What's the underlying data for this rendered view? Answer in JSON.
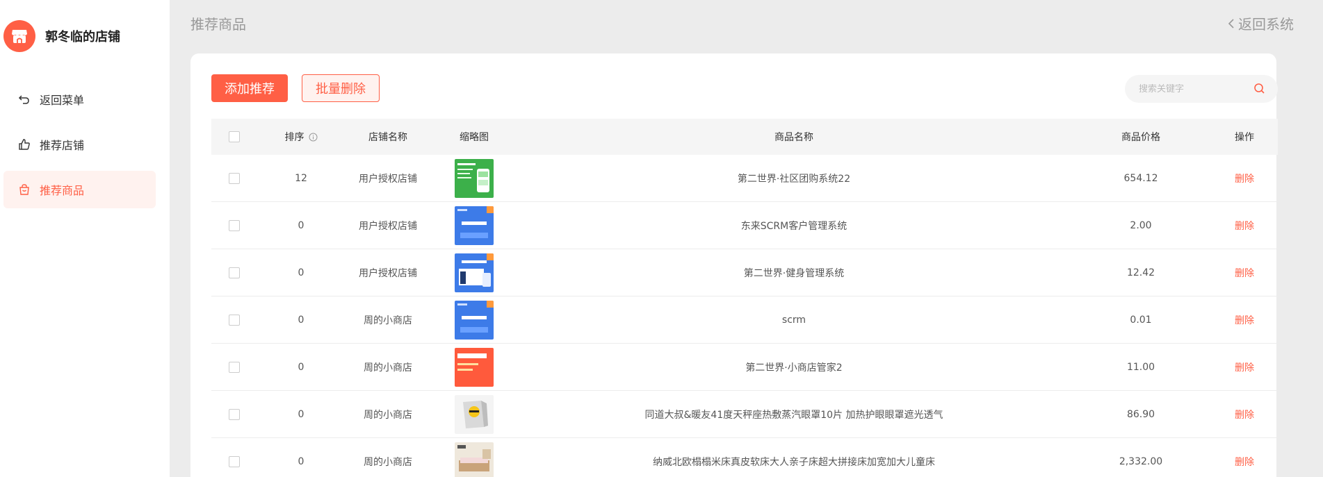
{
  "brand": {
    "name": "郭冬临的店铺"
  },
  "sidebar": {
    "items": [
      {
        "label": "返回菜单",
        "icon": "undo-icon",
        "active": false
      },
      {
        "label": "推荐店铺",
        "icon": "thumbs-up-icon",
        "active": false
      },
      {
        "label": "推荐商品",
        "icon": "shopping-bag-icon",
        "active": true
      }
    ]
  },
  "header": {
    "title": "推荐商品",
    "back_label": "返回系统"
  },
  "toolbar": {
    "add_label": "添加推荐",
    "batch_delete_label": "批量删除",
    "search_placeholder": "搜索关键字"
  },
  "table": {
    "columns": {
      "sort": "排序",
      "shop": "店铺名称",
      "thumb": "缩略图",
      "name": "商品名称",
      "price": "商品价格",
      "op": "操作"
    },
    "rows": [
      {
        "sort": "12",
        "shop": "用户授权店铺",
        "name": "第二世界·社区团购系统22",
        "price": "654.12",
        "op": "删除"
      },
      {
        "sort": "0",
        "shop": "用户授权店铺",
        "name": "东来SCRM客户管理系统",
        "price": "2.00",
        "op": "删除"
      },
      {
        "sort": "0",
        "shop": "用户授权店铺",
        "name": "第二世界·健身管理系统",
        "price": "12.42",
        "op": "删除"
      },
      {
        "sort": "0",
        "shop": "周的小商店",
        "name": "scrm",
        "price": "0.01",
        "op": "删除"
      },
      {
        "sort": "0",
        "shop": "周的小商店",
        "name": "第二世界·小商店管家2",
        "price": "11.00",
        "op": "删除"
      },
      {
        "sort": "0",
        "shop": "周的小商店",
        "name": "同道大叔&暖友41度天秤座热敷蒸汽眼罩10片 加热护眼眼罩遮光透气",
        "price": "86.90",
        "op": "删除"
      },
      {
        "sort": "0",
        "shop": "周的小商店",
        "name": "纳威北欧榻榻米床真皮软床大人亲子床超大拼接床加宽加大儿童床",
        "price": "2,332.00",
        "op": "删除"
      }
    ]
  },
  "colors": {
    "accent": "#ff5f45",
    "background": "#ececec"
  }
}
